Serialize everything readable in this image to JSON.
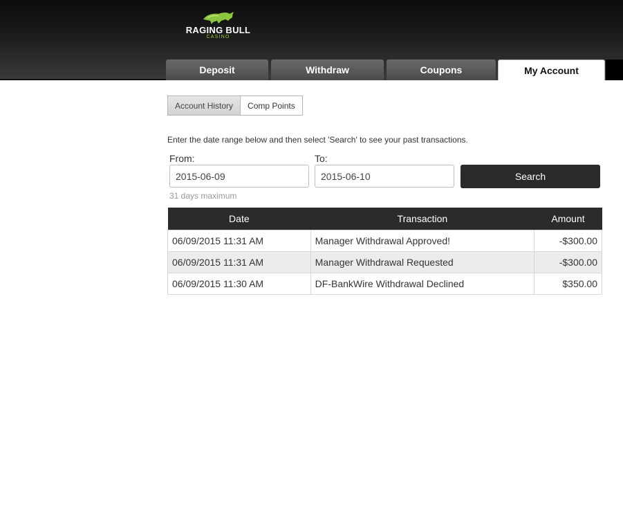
{
  "brand": {
    "name": "RAGING BULL",
    "sub": "CASINO"
  },
  "nav": {
    "tabs": [
      {
        "label": "Deposit"
      },
      {
        "label": "Withdraw"
      },
      {
        "label": "Coupons"
      },
      {
        "label": "My Account"
      }
    ],
    "active": "My Account"
  },
  "subnav": {
    "items": [
      {
        "label": "Account History"
      },
      {
        "label": "Comp Points"
      }
    ],
    "active": "Account History"
  },
  "search": {
    "instructions": "Enter the date range below and then select 'Search' to see your past transactions.",
    "from_label": "From:",
    "from_value": "2015-06-09",
    "to_label": "To:",
    "to_value": "2015-06-10",
    "button_label": "Search",
    "hint": "31 days maximum"
  },
  "table": {
    "headers": [
      "Date",
      "Transaction",
      "Amount"
    ],
    "rows": [
      {
        "date": "06/09/2015 11:31 AM",
        "transaction": "Manager Withdrawal Approved!",
        "amount": "-$300.00"
      },
      {
        "date": "06/09/2015 11:31 AM",
        "transaction": "Manager Withdrawal Requested",
        "amount": "-$300.00"
      },
      {
        "date": "06/09/2015 11:30 AM",
        "transaction": "DF-BankWire Withdrawal Declined",
        "amount": "$350.00"
      }
    ]
  },
  "colors": {
    "accent": "#9ad02c",
    "header_dark": "#1c1c1c",
    "button_dark": "#2a2a2a"
  }
}
